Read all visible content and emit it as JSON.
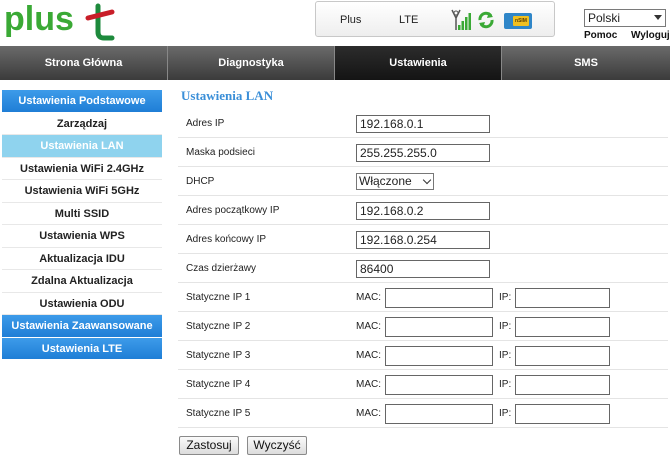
{
  "brand": {
    "logo_text": "plus",
    "accent": "#3aa935",
    "accent2": "#1d8a3c"
  },
  "status": {
    "operator": "Plus",
    "technology": "LTE",
    "signal_icon": "signal-bars-icon",
    "refresh_icon": "refresh-icon",
    "sim_icon": "sim-card-icon",
    "sim_chip_text": "nSIM"
  },
  "language": {
    "selected": "Polski"
  },
  "links": {
    "help": "Pomoc",
    "logout": "Wyloguj"
  },
  "nav": [
    {
      "label": "Strona Główna",
      "active": false
    },
    {
      "label": "Diagnostyka",
      "active": false
    },
    {
      "label": "Ustawienia",
      "active": true
    },
    {
      "label": "SMS",
      "active": false
    }
  ],
  "sidebar": [
    {
      "label": "Ustawienia Podstawowe",
      "type": "header"
    },
    {
      "label": "Zarządzaj",
      "type": "item"
    },
    {
      "label": "Ustawienia LAN",
      "type": "active"
    },
    {
      "label": "Ustawienia WiFi 2.4GHz",
      "type": "item"
    },
    {
      "label": "Ustawienia WiFi 5GHz",
      "type": "item"
    },
    {
      "label": "Multi SSID",
      "type": "item"
    },
    {
      "label": "Ustawienia WPS",
      "type": "item"
    },
    {
      "label": "Aktualizacja IDU",
      "type": "item"
    },
    {
      "label": "Zdalna Aktualizacja",
      "type": "item"
    },
    {
      "label": "Ustawienia ODU",
      "type": "item"
    },
    {
      "label": "Ustawienia Zaawansowane",
      "type": "header"
    },
    {
      "label": "Ustawienia LTE",
      "type": "header"
    }
  ],
  "main": {
    "title": "Ustawienia LAN",
    "fields": [
      {
        "label": "Adres IP",
        "value": "192.168.0.1"
      },
      {
        "label": "Maska podsieci",
        "value": "255.255.255.0"
      },
      {
        "label": "DHCP",
        "select": "Włączone"
      },
      {
        "label": "Adres początkowy IP",
        "value": "192.168.0.2"
      },
      {
        "label": "Adres końcowy IP",
        "value": "192.168.0.254"
      },
      {
        "label": "Czas dzierżawy",
        "value": "86400"
      }
    ],
    "static_ips": [
      {
        "label": "Statyczne IP 1",
        "mac": "",
        "ip": ""
      },
      {
        "label": "Statyczne IP 2",
        "mac": "",
        "ip": ""
      },
      {
        "label": "Statyczne IP 3",
        "mac": "",
        "ip": ""
      },
      {
        "label": "Statyczne IP 4",
        "mac": "",
        "ip": ""
      },
      {
        "label": "Statyczne IP 5",
        "mac": "",
        "ip": ""
      }
    ],
    "mac_label": "MAC:",
    "ip_label": "IP:",
    "apply_label": "Zastosuj",
    "clear_label": "Wyczyść"
  }
}
